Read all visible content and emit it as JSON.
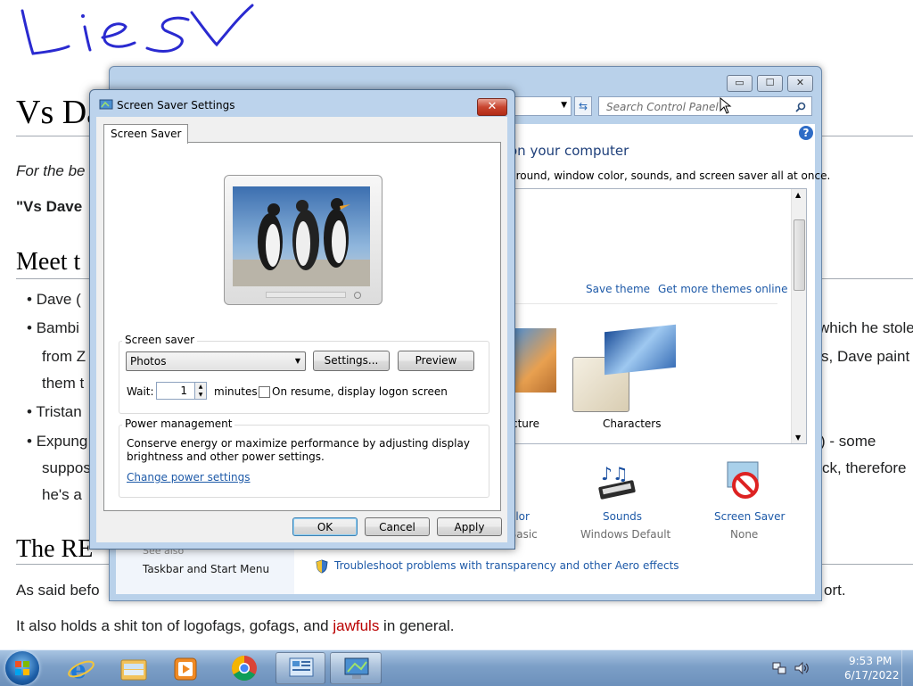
{
  "wiki": {
    "title": "Vs Da",
    "italic_line": "For the be",
    "quote_line": "\"Vs Dave",
    "section_meet": "Meet t",
    "bullets": [
      "Dave (",
      "Bambi",
      "from Z",
      "them t",
      "Tristan",
      "Expung",
      "suppos",
      "he's a"
    ],
    "right_fragments": [
      "which he stole",
      "s, Dave paint",
      ") - some",
      "ck, therefore"
    ],
    "section_re": "The RE",
    "said_before": "As said befo",
    "said_before_right": "ort.",
    "last_line_pre": "It also holds a shit ton of logofags, gofags, and ",
    "last_line_link": "jawfuls",
    "last_line_post": " in general.",
    "handwriting": "Lie SV"
  },
  "control_panel": {
    "search_placeholder": "Search Control Panel",
    "heading": "on your computer",
    "subheading": "ground, window color, sounds, and screen saver all at once.",
    "save_theme": "Save theme",
    "get_more_themes": "Get more themes online",
    "theme_picture_label": "cture",
    "theme_characters_label": "Characters",
    "color_label": "olor",
    "color_sub": "Basic",
    "sounds_label": "Sounds",
    "sounds_sub": "Windows Default",
    "screensaver_label": "Screen Saver",
    "screensaver_sub": "None",
    "see_also": "See also",
    "taskbar_link": "Taskbar and Start Menu",
    "troubleshoot": "Troubleshoot problems with transparency and other Aero effects"
  },
  "dialog": {
    "title": "Screen Saver Settings",
    "tab": "Screen Saver",
    "screen_saver_group": "Screen saver",
    "selected_saver": "Photos",
    "settings_btn": "Settings...",
    "preview_btn": "Preview",
    "wait_label": "Wait:",
    "wait_value": "1",
    "minutes_label": "minutes",
    "resume_label": "On resume, display logon screen",
    "power_group": "Power management",
    "power_text_1": "Conserve energy or maximize performance by adjusting display",
    "power_text_2": "brightness and other power settings.",
    "power_link": "Change power settings",
    "ok": "OK",
    "cancel": "Cancel",
    "apply": "Apply"
  },
  "taskbar": {
    "time": "9:53 PM",
    "date": "6/17/2022"
  },
  "colors": {
    "link": "#1e5aa8",
    "accent": "#3c7fb1",
    "handwriting": "#2a2ad0"
  }
}
